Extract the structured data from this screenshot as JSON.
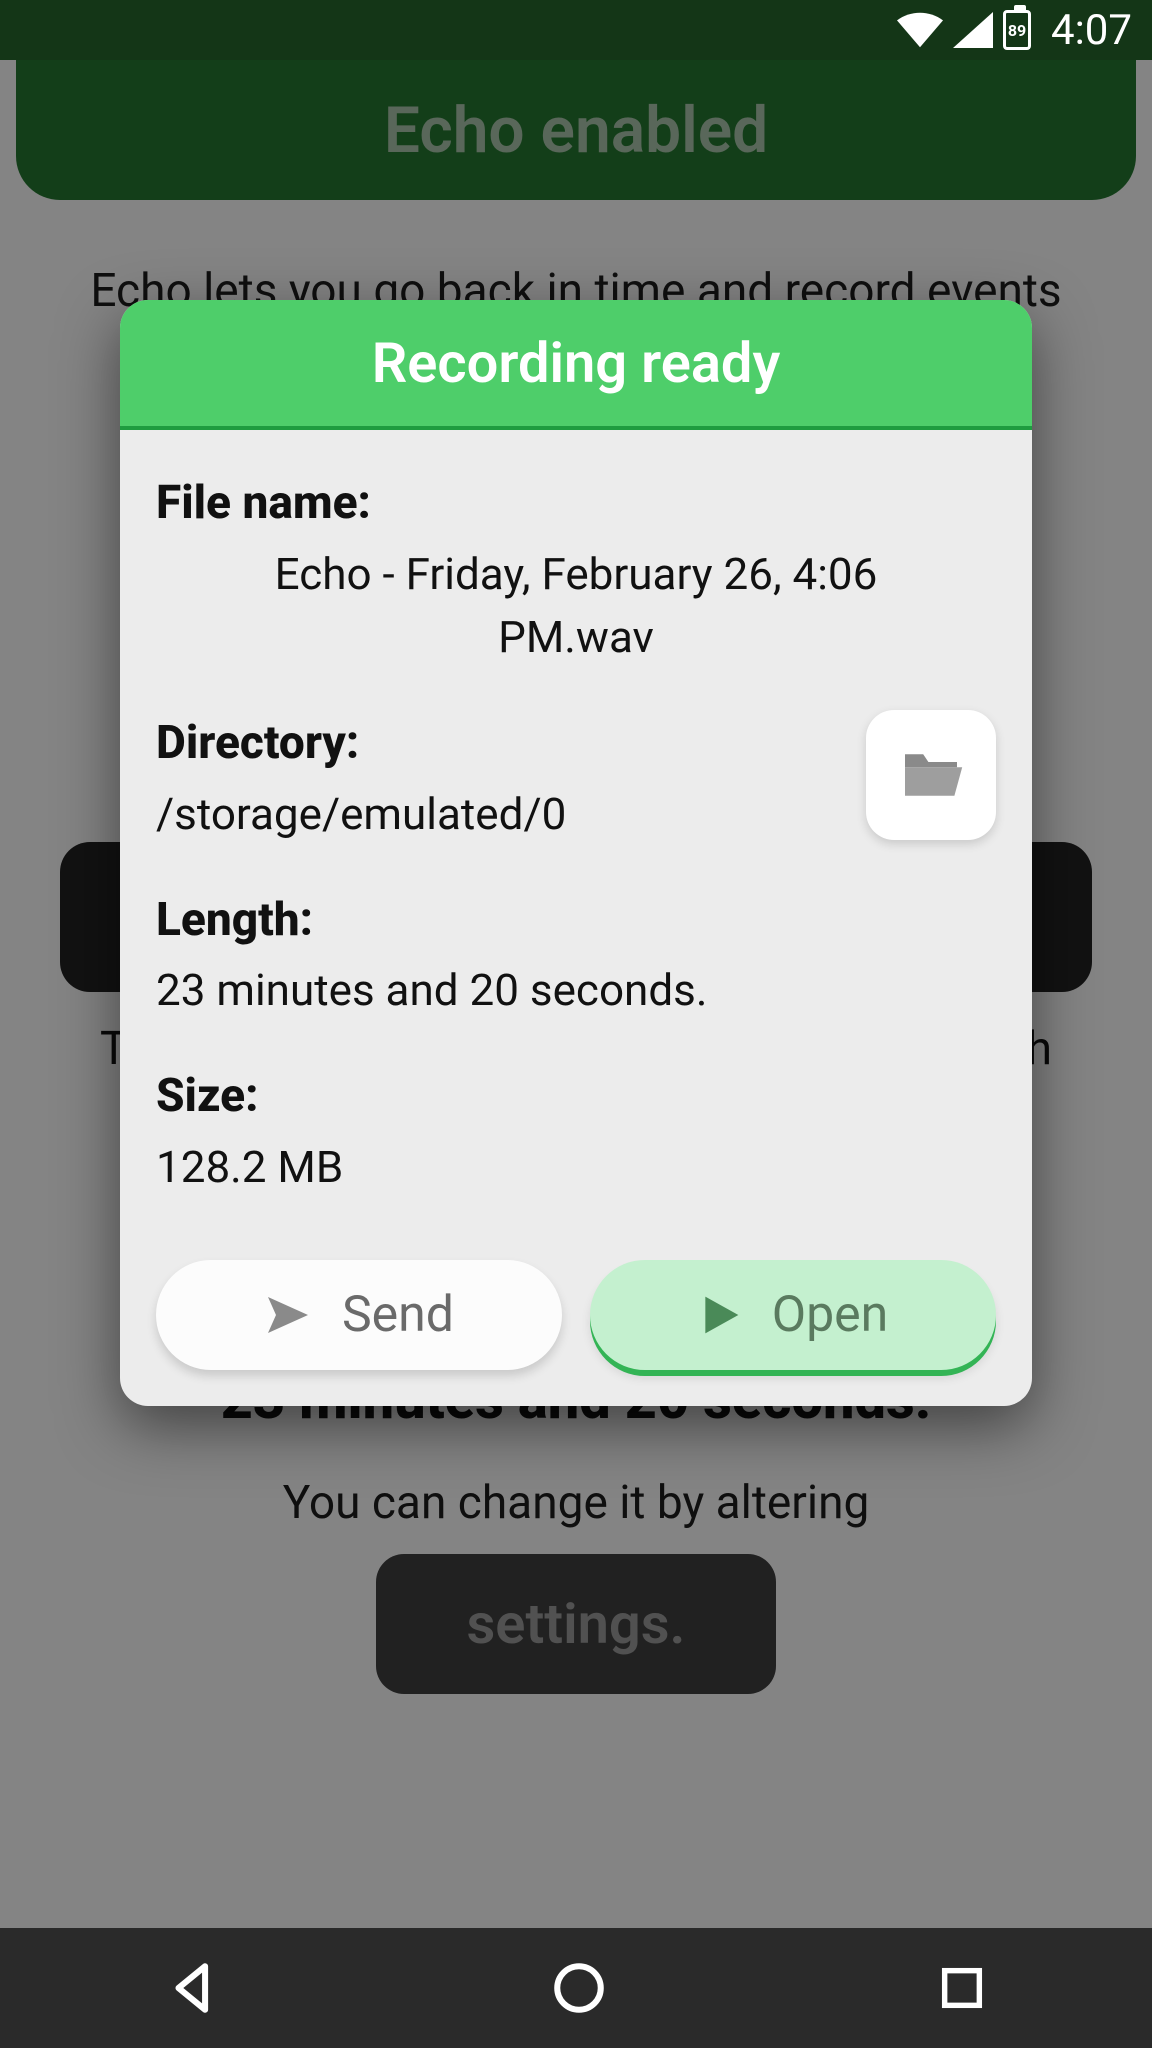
{
  "status_bar": {
    "battery_pct": "89",
    "time": "4:07"
  },
  "background": {
    "header_title": "Echo enabled",
    "intro_text": "Echo lets you go back in time and record events",
    "duration_text": "23 minutes and 20 seconds.",
    "alter_text": "You can change it by altering",
    "settings_label": "settings.",
    "letter_T": "T",
    "letter_h": "h"
  },
  "dialog": {
    "title": "Recording ready",
    "file_name_label": "File name:",
    "file_name_value": "Echo - Friday, February 26, 4:06 PM.wav",
    "directory_label": "Directory:",
    "directory_value": "/storage/emulated/0",
    "length_label": "Length:",
    "length_value": "23 minutes and 20 seconds.",
    "size_label": "Size:",
    "size_value": "128.2 MB",
    "send_label": "Send",
    "open_label": "Open"
  }
}
